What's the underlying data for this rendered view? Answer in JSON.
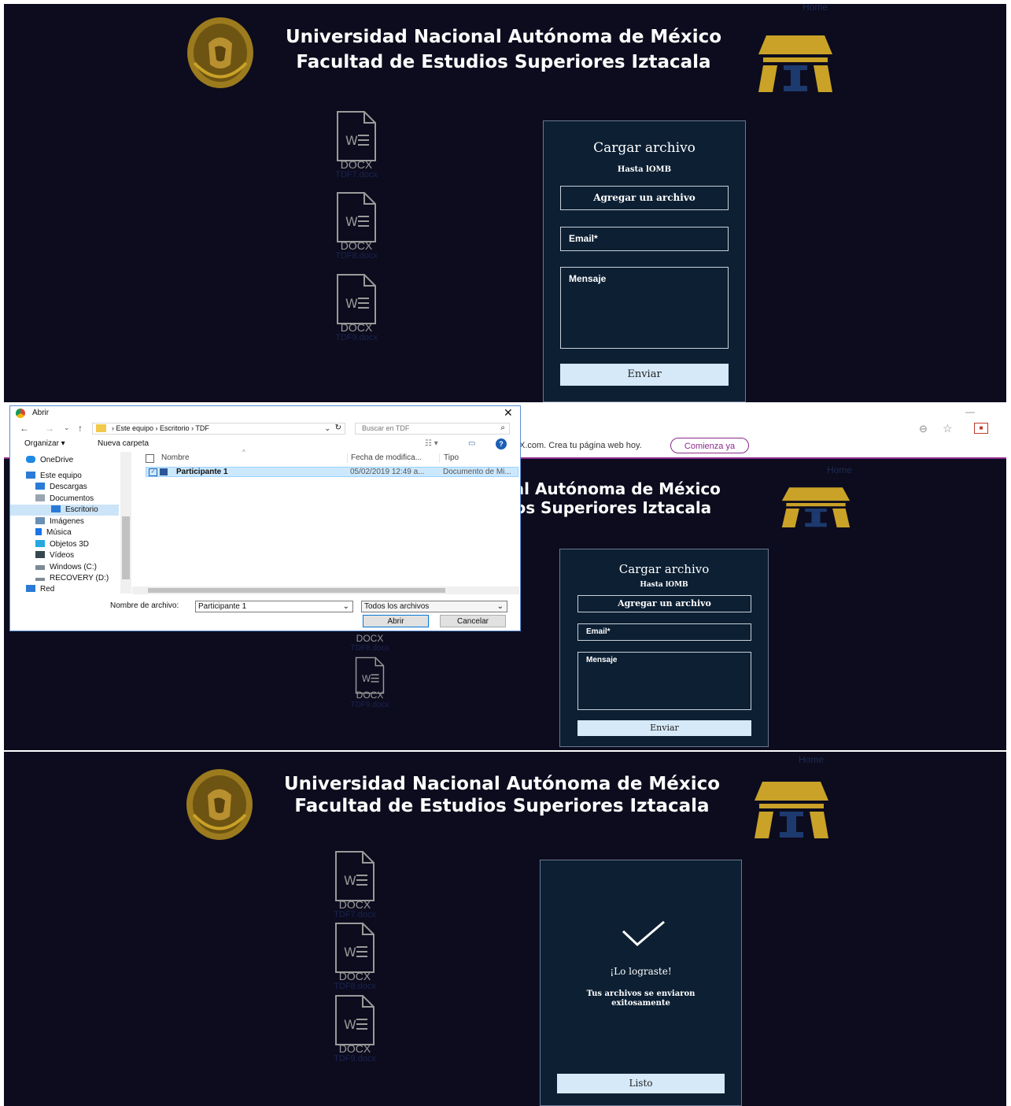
{
  "header": {
    "home_link": "Home",
    "university": "Universidad Nacional Autónoma de México",
    "faculty": "Facultad de Estudios Superiores Iztacala"
  },
  "files": [
    {
      "type": "DOCX",
      "name": "TDF7.docx"
    },
    {
      "type": "DOCX",
      "name": "TDF8.docx"
    },
    {
      "type": "DOCX",
      "name": "TDF9.docx"
    }
  ],
  "upload_card": {
    "title": "Cargar archivo",
    "limit": "Hasta lOMB",
    "add_file_label": "Agregar un archivo",
    "email_placeholder": "Email*",
    "message_placeholder": "Mensaje",
    "send_label": "Enviar"
  },
  "success_card": {
    "title": "¡Lo lograste!",
    "message_line1": "Tus archivos se enviaron",
    "message_line2": "exitosamente",
    "done_label": "Listo"
  },
  "browser": {
    "ad_text": "X.com. Crea tu página web hoy.",
    "ad_button": "Comienza ya"
  },
  "dialog": {
    "title": "Abrir",
    "breadcrumb": [
      "Este equipo",
      "Escritorio",
      "TDF"
    ],
    "search_placeholder": "Buscar en TDF",
    "toolbar": {
      "organize": "Organizar ▾",
      "new_folder": "Nueva carpeta"
    },
    "nav_items": [
      {
        "label": "OneDrive",
        "icon": "cloud-icon"
      },
      {
        "label": "Este equipo",
        "icon": "computer-icon"
      },
      {
        "label": "Descargas",
        "icon": "download-icon"
      },
      {
        "label": "Documentos",
        "icon": "documents-icon"
      },
      {
        "label": "Escritorio",
        "icon": "desktop-icon",
        "selected": true
      },
      {
        "label": "Imágenes",
        "icon": "images-icon"
      },
      {
        "label": "Música",
        "icon": "music-icon"
      },
      {
        "label": "Objetos 3D",
        "icon": "cube-icon"
      },
      {
        "label": "Vídeos",
        "icon": "video-icon"
      },
      {
        "label": "Windows (C:)",
        "icon": "drive-icon"
      },
      {
        "label": "RECOVERY (D:)",
        "icon": "drive-icon"
      },
      {
        "label": "Red",
        "icon": "network-icon"
      }
    ],
    "columns": [
      "Nombre",
      "Fecha de modifica...",
      "Tipo"
    ],
    "rows": [
      {
        "name": "Participante 1",
        "date": "05/02/2019 12:49 a...",
        "type": "Documento de Mi..."
      }
    ],
    "filename_label": "Nombre de archivo:",
    "filename_value": "Participante 1",
    "filter_value": "Todos los archivos",
    "open_button": "Abrir",
    "cancel_button": "Cancelar"
  },
  "colors": {
    "page_bg": "#0c0c1e",
    "card_bg": "#0c1f33",
    "button_fill": "#d5e9f8",
    "logo_gold": "#c9a227",
    "logo_blue": "#1d3a6e",
    "accent_purple": "#8b2b8e"
  }
}
